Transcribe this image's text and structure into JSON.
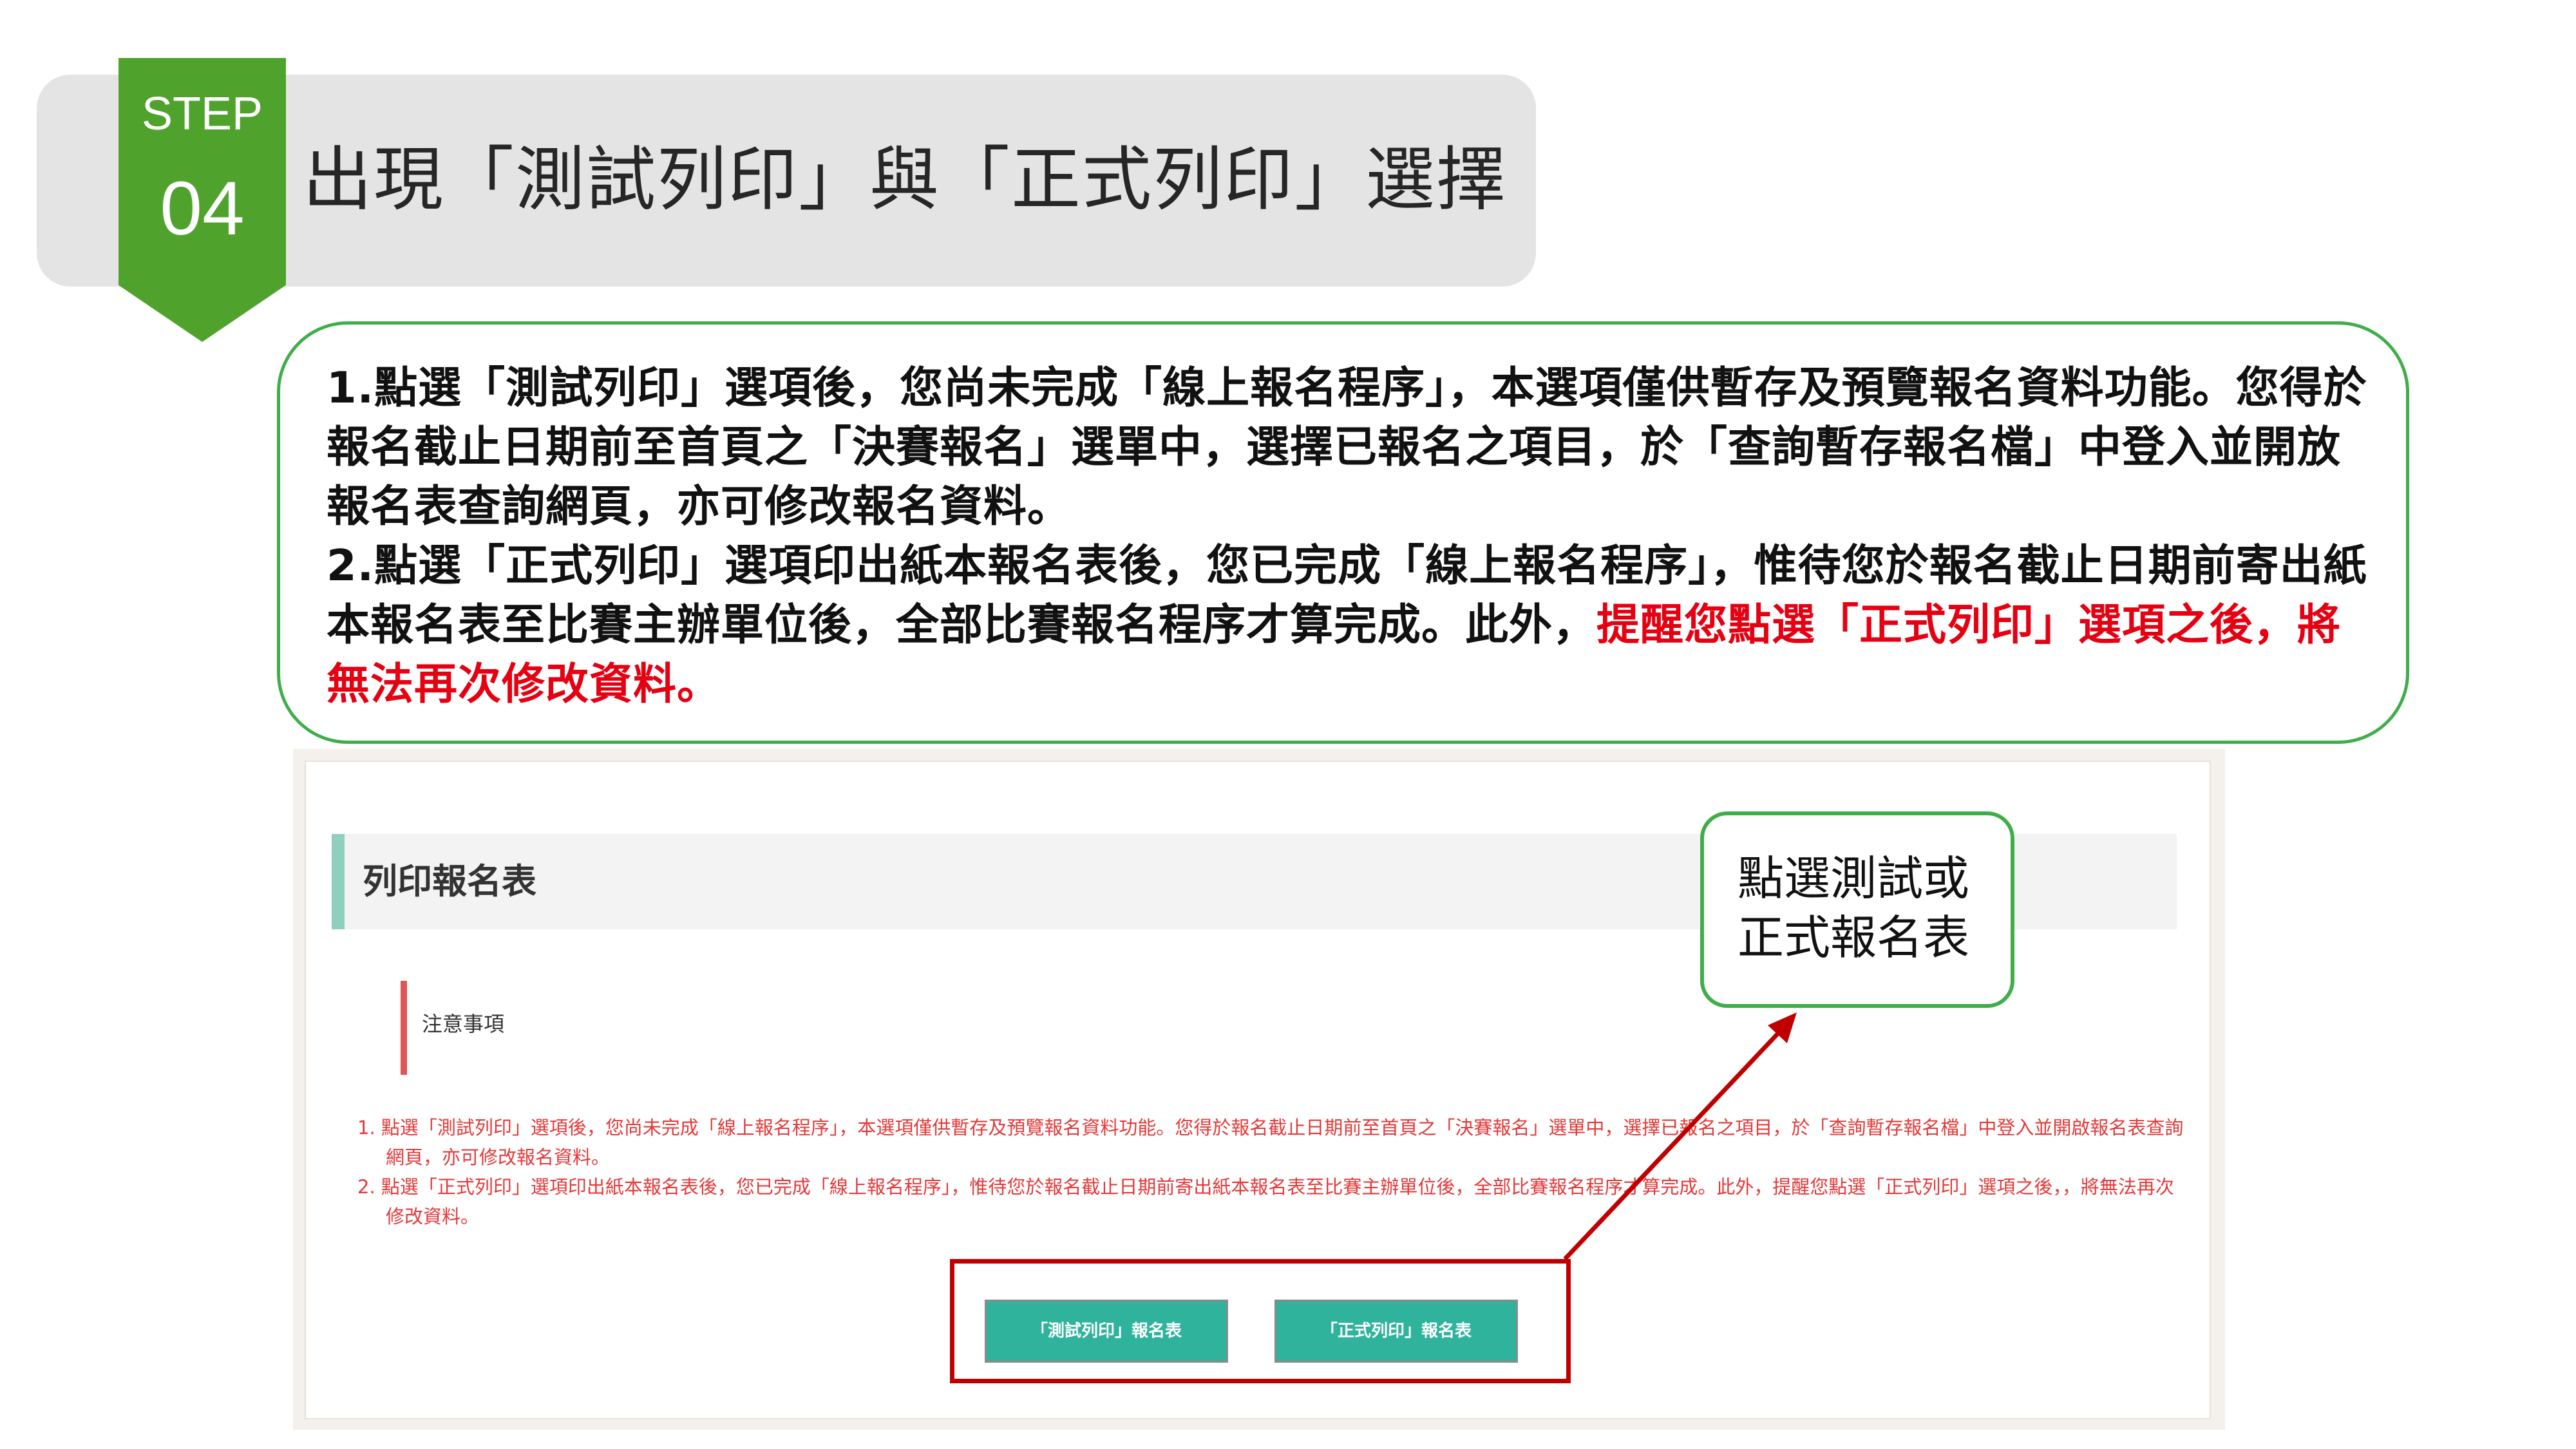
{
  "step": {
    "label": "STEP",
    "number": "04",
    "title": "出現「測試列印」與「正式列印」選擇"
  },
  "info": {
    "line1": "1.點選「測試列印」選項後，您尚未完成「線上報名程序」，本選項僅供暫存及預覽報名資料功能。您得於報名截止日期前至首頁之「決賽報名」選單中，選擇已報名之項目，於「查詢暫存報名檔」中登入並開放報名表查詢網頁，亦可修改報名資料。",
    "line2_black": "2.點選「正式列印」選項印出紙本報名表後，您已完成「線上報名程序」，惟待您於報名截止日期前寄出紙本報名表至比賽主辦單位後，全部比賽報名程序才算完成。此外，",
    "line2_red": "提醒您點選「正式列印」選項之後，將無法再次修改資料。"
  },
  "screenshot": {
    "page_title": "列印報名表",
    "notice_label": "注意事項",
    "notice_items": [
      "1. 點選「測試列印」選項後，您尚未完成「線上報名程序」，本選項僅供暫存及預覽報名資料功能。您得於報名截止日期前至首頁之「決賽報名」選單中，選擇已報名之項目，於「查詢暫存報名檔」中登入並開啟報名表查詢網頁，亦可修改報名資料。",
      "2. 點選「正式列印」選項印出紙本報名表後，您已完成「線上報名程序」，惟待您於報名截止日期前寄出紙本報名表至比賽主辦單位後，全部比賽報名程序才算完成。此外，提醒您點選「正式列印」選項之後，，將無法再次修改資料。"
    ],
    "btn_test": "「測試列印」報名表",
    "btn_formal": "「正式列印」報名表"
  },
  "callout": {
    "text": "點選測試或正式報名表"
  },
  "colors": {
    "badge_green": "#4fa32c",
    "border_green": "#3fae49",
    "warning_red": "#e50012",
    "button_teal": "#2fb39c",
    "highlight_red": "#c00000"
  }
}
